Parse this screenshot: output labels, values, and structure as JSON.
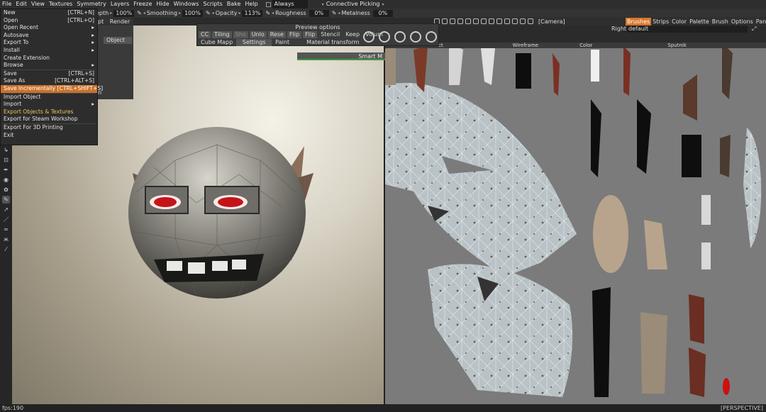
{
  "menubar": {
    "items": [
      "File",
      "Edit",
      "View",
      "Textures",
      "Symmetry",
      "Layers",
      "Freeze",
      "Hide",
      "Windows",
      "Scripts",
      "Bake",
      "Help"
    ],
    "always_label": "Always",
    "connective_label": "Connective Picking"
  },
  "toolbar": {
    "depth_label": "epth",
    "depth_value": "100%",
    "smoothing_label": "Smoothing",
    "smoothing_value": "100%",
    "opacity_label": "Opacity",
    "opacity_value": "113%",
    "roughness_label": "Roughness",
    "roughness_value": "0%",
    "metalness_label": "Metalness",
    "metalness_value": "0%",
    "script_label": "pt",
    "render_label": "Render"
  },
  "right_panel": {
    "camera_label": "[Camera]",
    "tabs": [
      "Brushes",
      "Strips",
      "Color",
      "Palette",
      "Brush",
      "Options",
      "Panel"
    ],
    "right_label": "Right",
    "default_label": "default"
  },
  "file_menu": {
    "items": [
      {
        "label": "New",
        "shortcut": "[CTRL+N]",
        "arrow": ""
      },
      {
        "label": "Open",
        "shortcut": "[CTRL+O]",
        "arrow": ""
      },
      {
        "label": "Open  Recent",
        "shortcut": "",
        "arrow": "▸"
      },
      {
        "label": "Autosave",
        "shortcut": "",
        "arrow": "▸"
      },
      {
        "label": "Export  To",
        "shortcut": "",
        "arrow": "▸"
      },
      {
        "label": "Install",
        "shortcut": "",
        "arrow": "▸"
      },
      {
        "label": "Create  Extension",
        "shortcut": "",
        "arrow": ""
      },
      {
        "label": "Browse",
        "shortcut": "",
        "arrow": "▸"
      },
      {
        "label": "Save",
        "shortcut": "[CTRL+S]",
        "arrow": ""
      },
      {
        "label": "Save  As",
        "shortcut": "[CTRL+ALT+S]",
        "arrow": ""
      },
      {
        "label": "Save  Incrementally  [CTRL+SHIFT+S]",
        "shortcut": "",
        "arrow": ""
      },
      {
        "label": "Import  Object",
        "shortcut": "",
        "arrow": ""
      },
      {
        "label": "Import",
        "shortcut": "",
        "arrow": "▸"
      },
      {
        "label": "Export  Objects  &  Textures",
        "shortcut": "",
        "arrow": ""
      },
      {
        "label": "Export  for  Steam  Workshop",
        "shortcut": "",
        "arrow": ""
      },
      {
        "label": "Export  For  3D  Printing",
        "shortcut": "",
        "arrow": ""
      },
      {
        "label": "Exit",
        "shortcut": "",
        "arrow": ""
      }
    ],
    "behind_object": "Object",
    "behind_m": "n"
  },
  "preview": {
    "title": "Preview  options",
    "row1": [
      "CC",
      "Tiling",
      "Sho",
      "Unlo",
      "Rese",
      "Flip",
      "Flip",
      "Stencil",
      "Keep",
      "Volum"
    ],
    "row2": [
      "Cube  Mapp",
      "Settings",
      "Paint",
      "Material  transform"
    ]
  },
  "smart_label": "Smart  M",
  "uv_header": [
    "ct",
    "Wireframe",
    "Color",
    "Sputnik"
  ],
  "status": {
    "fps": "fps:190",
    "mode": "[PERSPECTIVE]"
  },
  "colors": {
    "accent": "#d9762b",
    "highlight": "#c9712b",
    "yellow": "#e9c55d"
  }
}
